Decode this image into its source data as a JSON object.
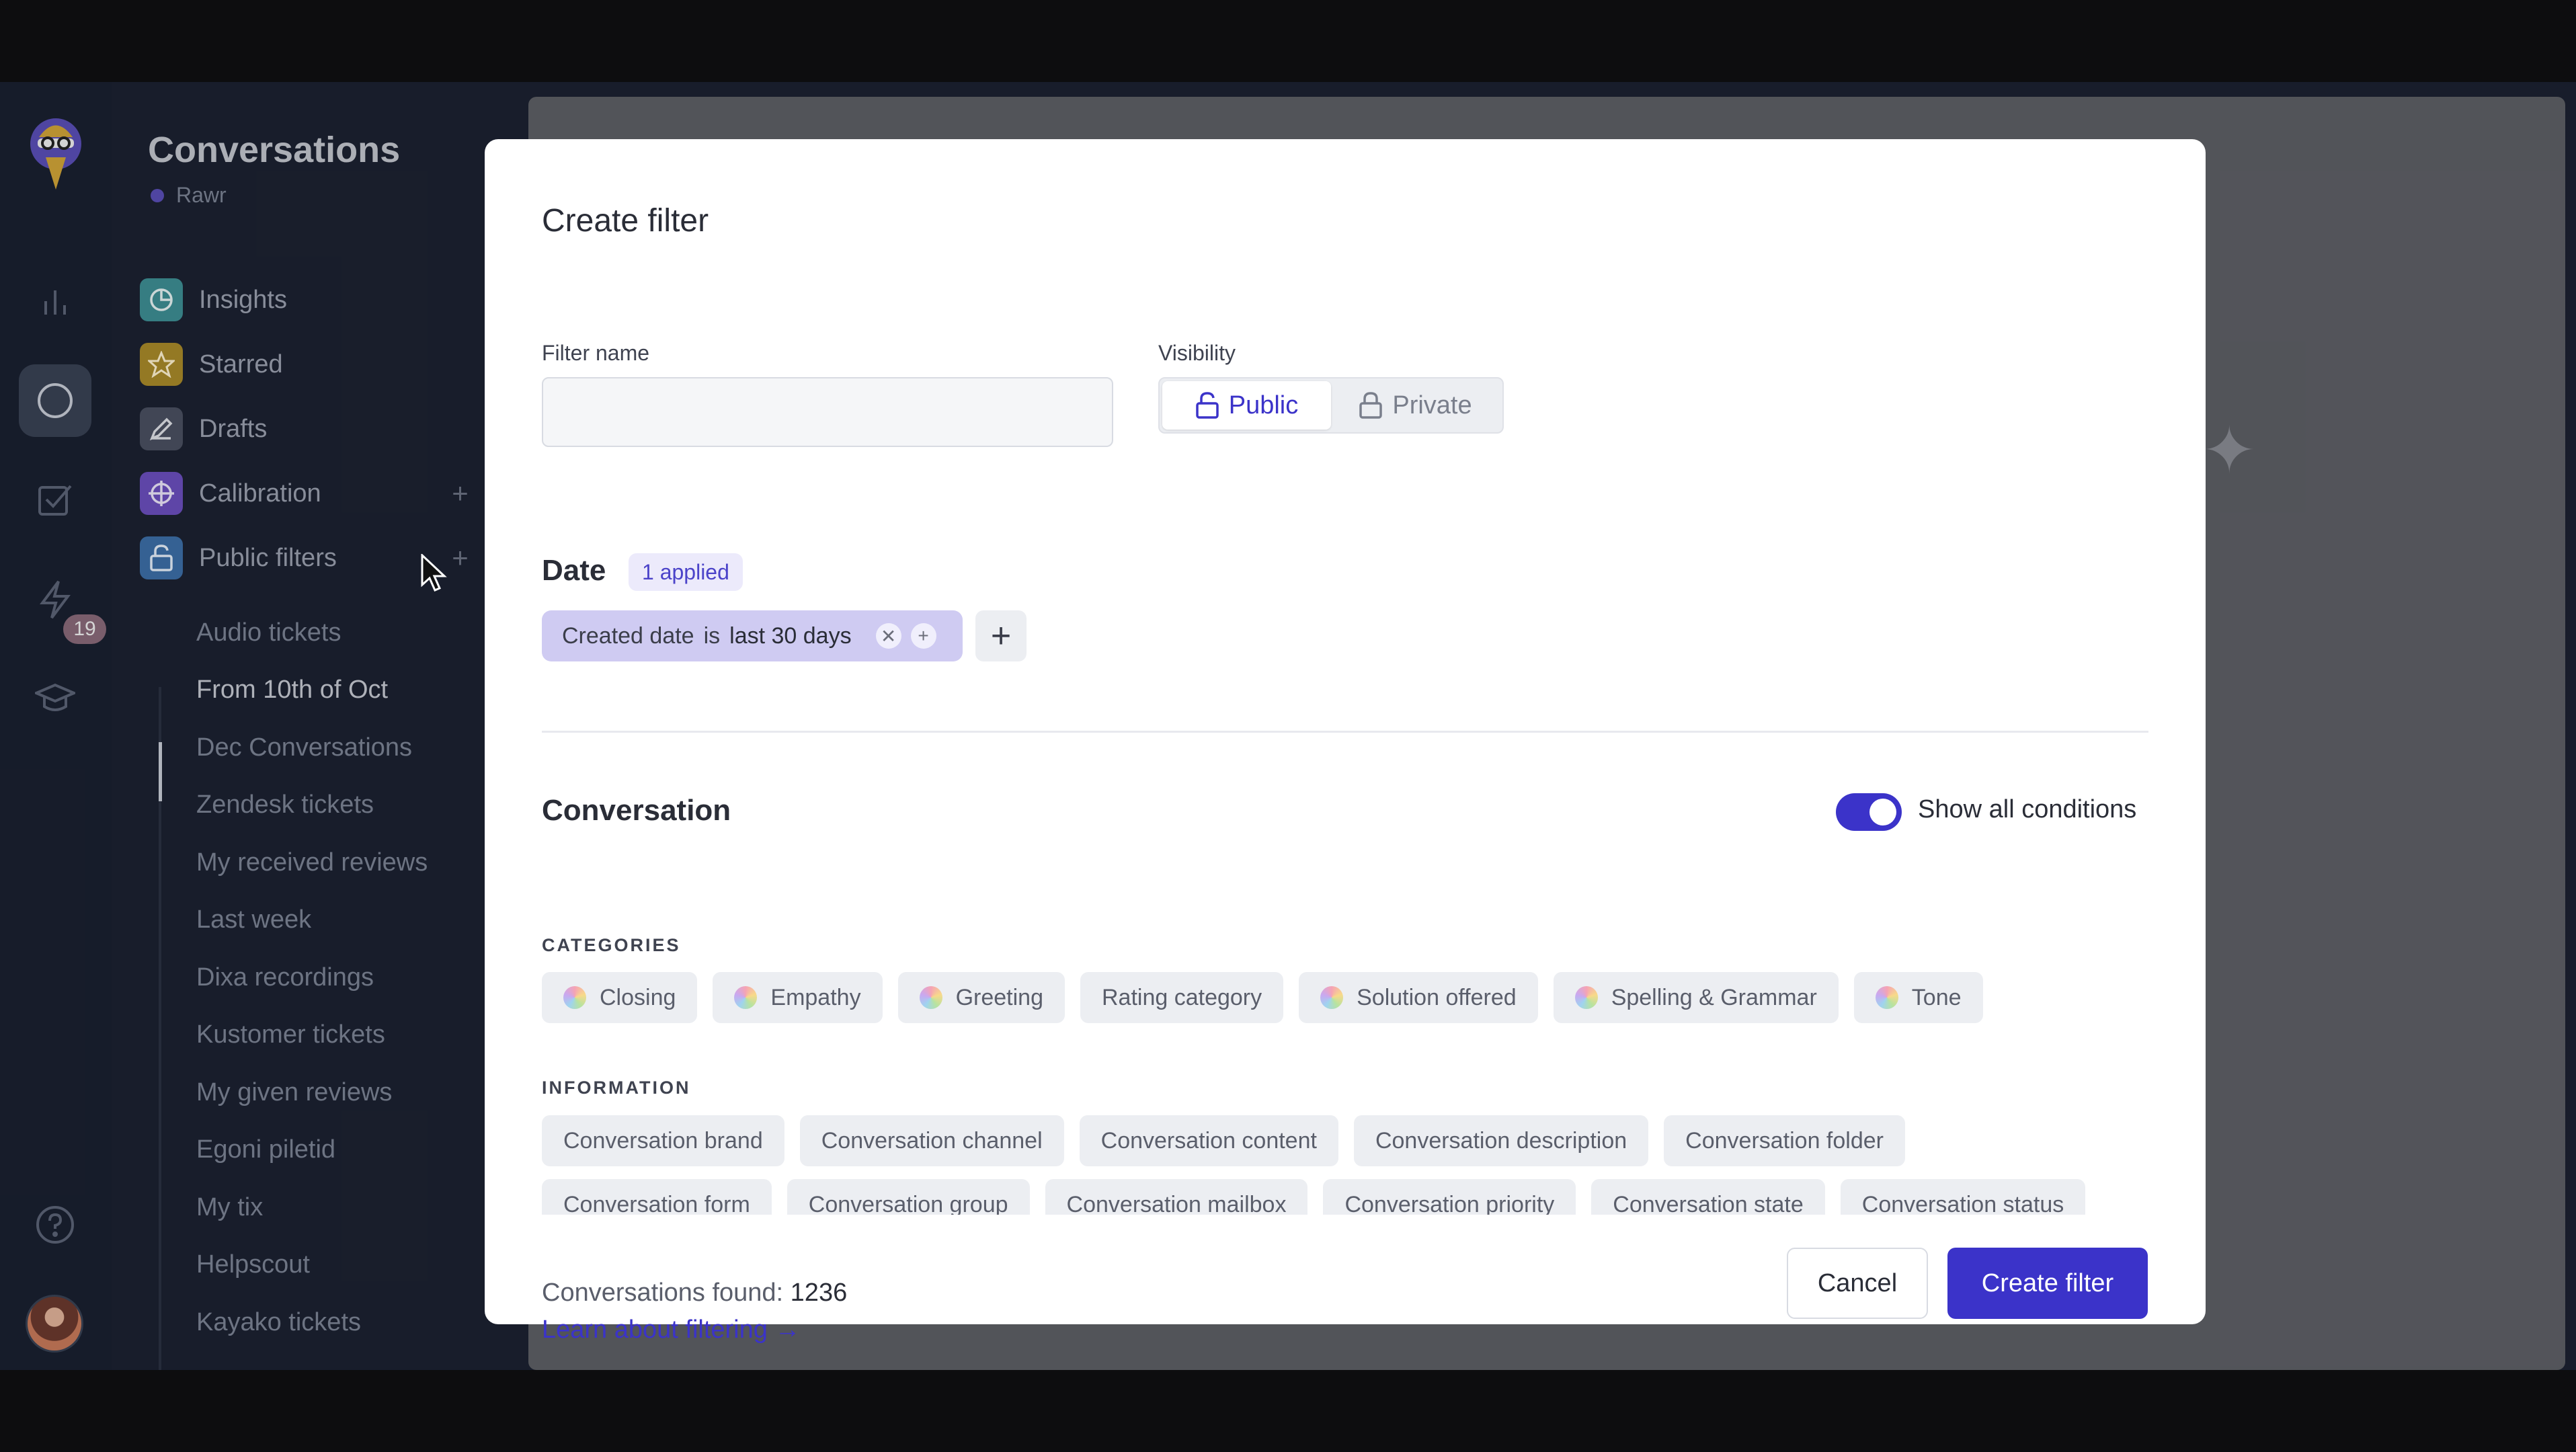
{
  "app": {
    "title": "Conversations",
    "workspace": "Rawr",
    "notification_count": "19"
  },
  "sidebar": {
    "items": [
      {
        "label": "Insights",
        "icon": "pie-chart-icon",
        "color": "#3e8f95"
      },
      {
        "label": "Starred",
        "icon": "star-icon",
        "color": "#a98a2a"
      },
      {
        "label": "Drafts",
        "icon": "pencil-icon",
        "color": "#4a5061"
      },
      {
        "label": "Calibration",
        "icon": "crosshair-icon",
        "color": "#6b4fbf"
      },
      {
        "label": "Public filters",
        "icon": "unlock-icon",
        "color": "#3d6fa8"
      }
    ],
    "public_filters": [
      "Audio tickets",
      "From 10th of Oct",
      "Dec Conversations",
      "Zendesk tickets",
      "My received reviews",
      "Last week",
      "Dixa recordings",
      "Kustomer tickets",
      "My given reviews",
      "Egoni piletid",
      "My tix",
      "Helpscout",
      "Kayako tickets"
    ],
    "active_filter": "From 10th of Oct"
  },
  "modal": {
    "title": "Create filter",
    "filter_name_label": "Filter name",
    "filter_name_value": "",
    "visibility_label": "Visibility",
    "visibility_options": [
      "Public",
      "Private"
    ],
    "visibility_selected": "Public",
    "date": {
      "title": "Date",
      "applied_badge": "1 applied",
      "condition": {
        "field": "Created date",
        "operator": "is",
        "value": "last 30 days"
      }
    },
    "conversation": {
      "title": "Conversation",
      "toggle_label": "Show all conditions",
      "toggle_on": true,
      "categories_label": "CATEGORIES",
      "categories": [
        {
          "label": "Closing",
          "swatch": true
        },
        {
          "label": "Empathy",
          "swatch": true
        },
        {
          "label": "Greeting",
          "swatch": true
        },
        {
          "label": "Rating category",
          "swatch": false
        },
        {
          "label": "Solution offered",
          "swatch": true
        },
        {
          "label": "Spelling & Grammar",
          "swatch": true
        },
        {
          "label": "Tone",
          "swatch": true
        }
      ],
      "information_label": "INFORMATION",
      "information_row1": [
        "Conversation brand",
        "Conversation channel",
        "Conversation content",
        "Conversation description",
        "Conversation folder"
      ],
      "information_row2": [
        "Conversation form",
        "Conversation group",
        "Conversation mailbox",
        "Conversation priority",
        "Conversation state",
        "Conversation status"
      ]
    },
    "footer": {
      "found_label": "Conversations found:",
      "found_count": "1236",
      "learn_link": "Learn about filtering →",
      "cancel": "Cancel",
      "create": "Create filter"
    }
  },
  "colors": {
    "accent": "#3b33c9",
    "sidebar_bg": "#1c2231"
  }
}
